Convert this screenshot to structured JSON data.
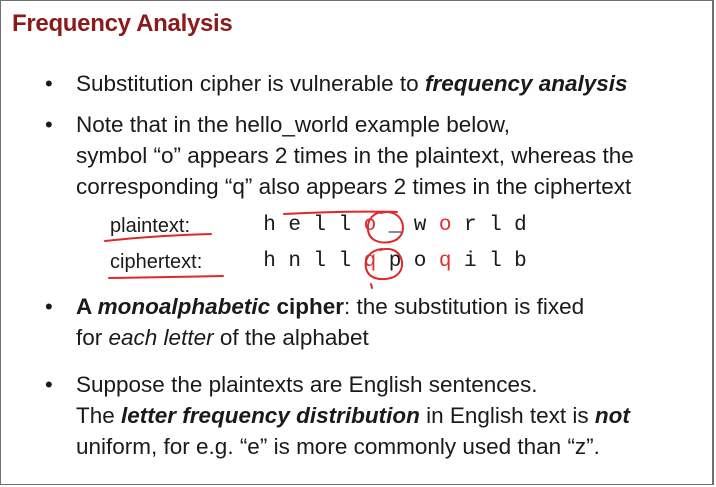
{
  "slide": {
    "title": "Frequency Analysis",
    "bullets": [
      {
        "lines": [
          [
            {
              "t": "Substitution cipher is vulnerable to ",
              "s": ""
            },
            {
              "t": "frequency analysis",
              "s": "bi"
            }
          ]
        ]
      },
      {
        "lines": [
          [
            {
              "t": "Note that in the hello_world example below,",
              "s": ""
            }
          ],
          [
            {
              "t": "symbol “o” appears 2 times in the plaintext, whereas the",
              "s": ""
            }
          ],
          [
            {
              "t": "corresponding “q” also appears 2 times in the ciphertext",
              "s": ""
            }
          ]
        ]
      },
      {
        "lines": [
          [
            {
              "t": "A ",
              "s": "b"
            },
            {
              "t": "monoalphabetic",
              "s": "bi"
            },
            {
              "t": " cipher",
              "s": "b"
            },
            {
              "t": ": the substitution is fixed",
              "s": ""
            }
          ],
          [
            {
              "t": "for ",
              "s": ""
            },
            {
              "t": "each letter",
              "s": "i"
            },
            {
              "t": " of the alphabet",
              "s": ""
            }
          ]
        ]
      },
      {
        "lines": [
          [
            {
              "t": "Suppose the plaintexts are English sentences.",
              "s": ""
            }
          ],
          [
            {
              "t": "The ",
              "s": ""
            },
            {
              "t": "letter frequency distribution",
              "s": "bi"
            },
            {
              "t": " in English text is ",
              "s": ""
            },
            {
              "t": "not",
              "s": "bi"
            }
          ],
          [
            {
              "t": "uniform, for e.g. “e” is more commonly used than “z”.",
              "s": ""
            }
          ]
        ]
      }
    ],
    "example": {
      "plaintext_label": "plaintext:",
      "ciphertext_label": "ciphertext:",
      "plaintext_chars": [
        {
          "c": "h",
          "red": false
        },
        {
          "c": "e",
          "red": false
        },
        {
          "c": "l",
          "red": false
        },
        {
          "c": "l",
          "red": false
        },
        {
          "c": "o",
          "red": true
        },
        {
          "c": "_",
          "red": false
        },
        {
          "c": "w",
          "red": false
        },
        {
          "c": "o",
          "red": true
        },
        {
          "c": "r",
          "red": false
        },
        {
          "c": "l",
          "red": false
        },
        {
          "c": "d",
          "red": false
        }
      ],
      "ciphertext_chars": [
        {
          "c": "h",
          "red": false
        },
        {
          "c": "n",
          "red": false
        },
        {
          "c": "l",
          "red": false
        },
        {
          "c": "l",
          "red": false
        },
        {
          "c": "q",
          "red": true
        },
        {
          "c": "p",
          "red": false
        },
        {
          "c": "o",
          "red": false
        },
        {
          "c": "q",
          "red": true
        },
        {
          "c": "i",
          "red": false
        },
        {
          "c": "l",
          "red": false
        },
        {
          "c": "b",
          "red": false
        }
      ]
    },
    "colors": {
      "title": "#8b1a1a",
      "highlight": "#e03030",
      "annotation": "#e02828"
    }
  }
}
